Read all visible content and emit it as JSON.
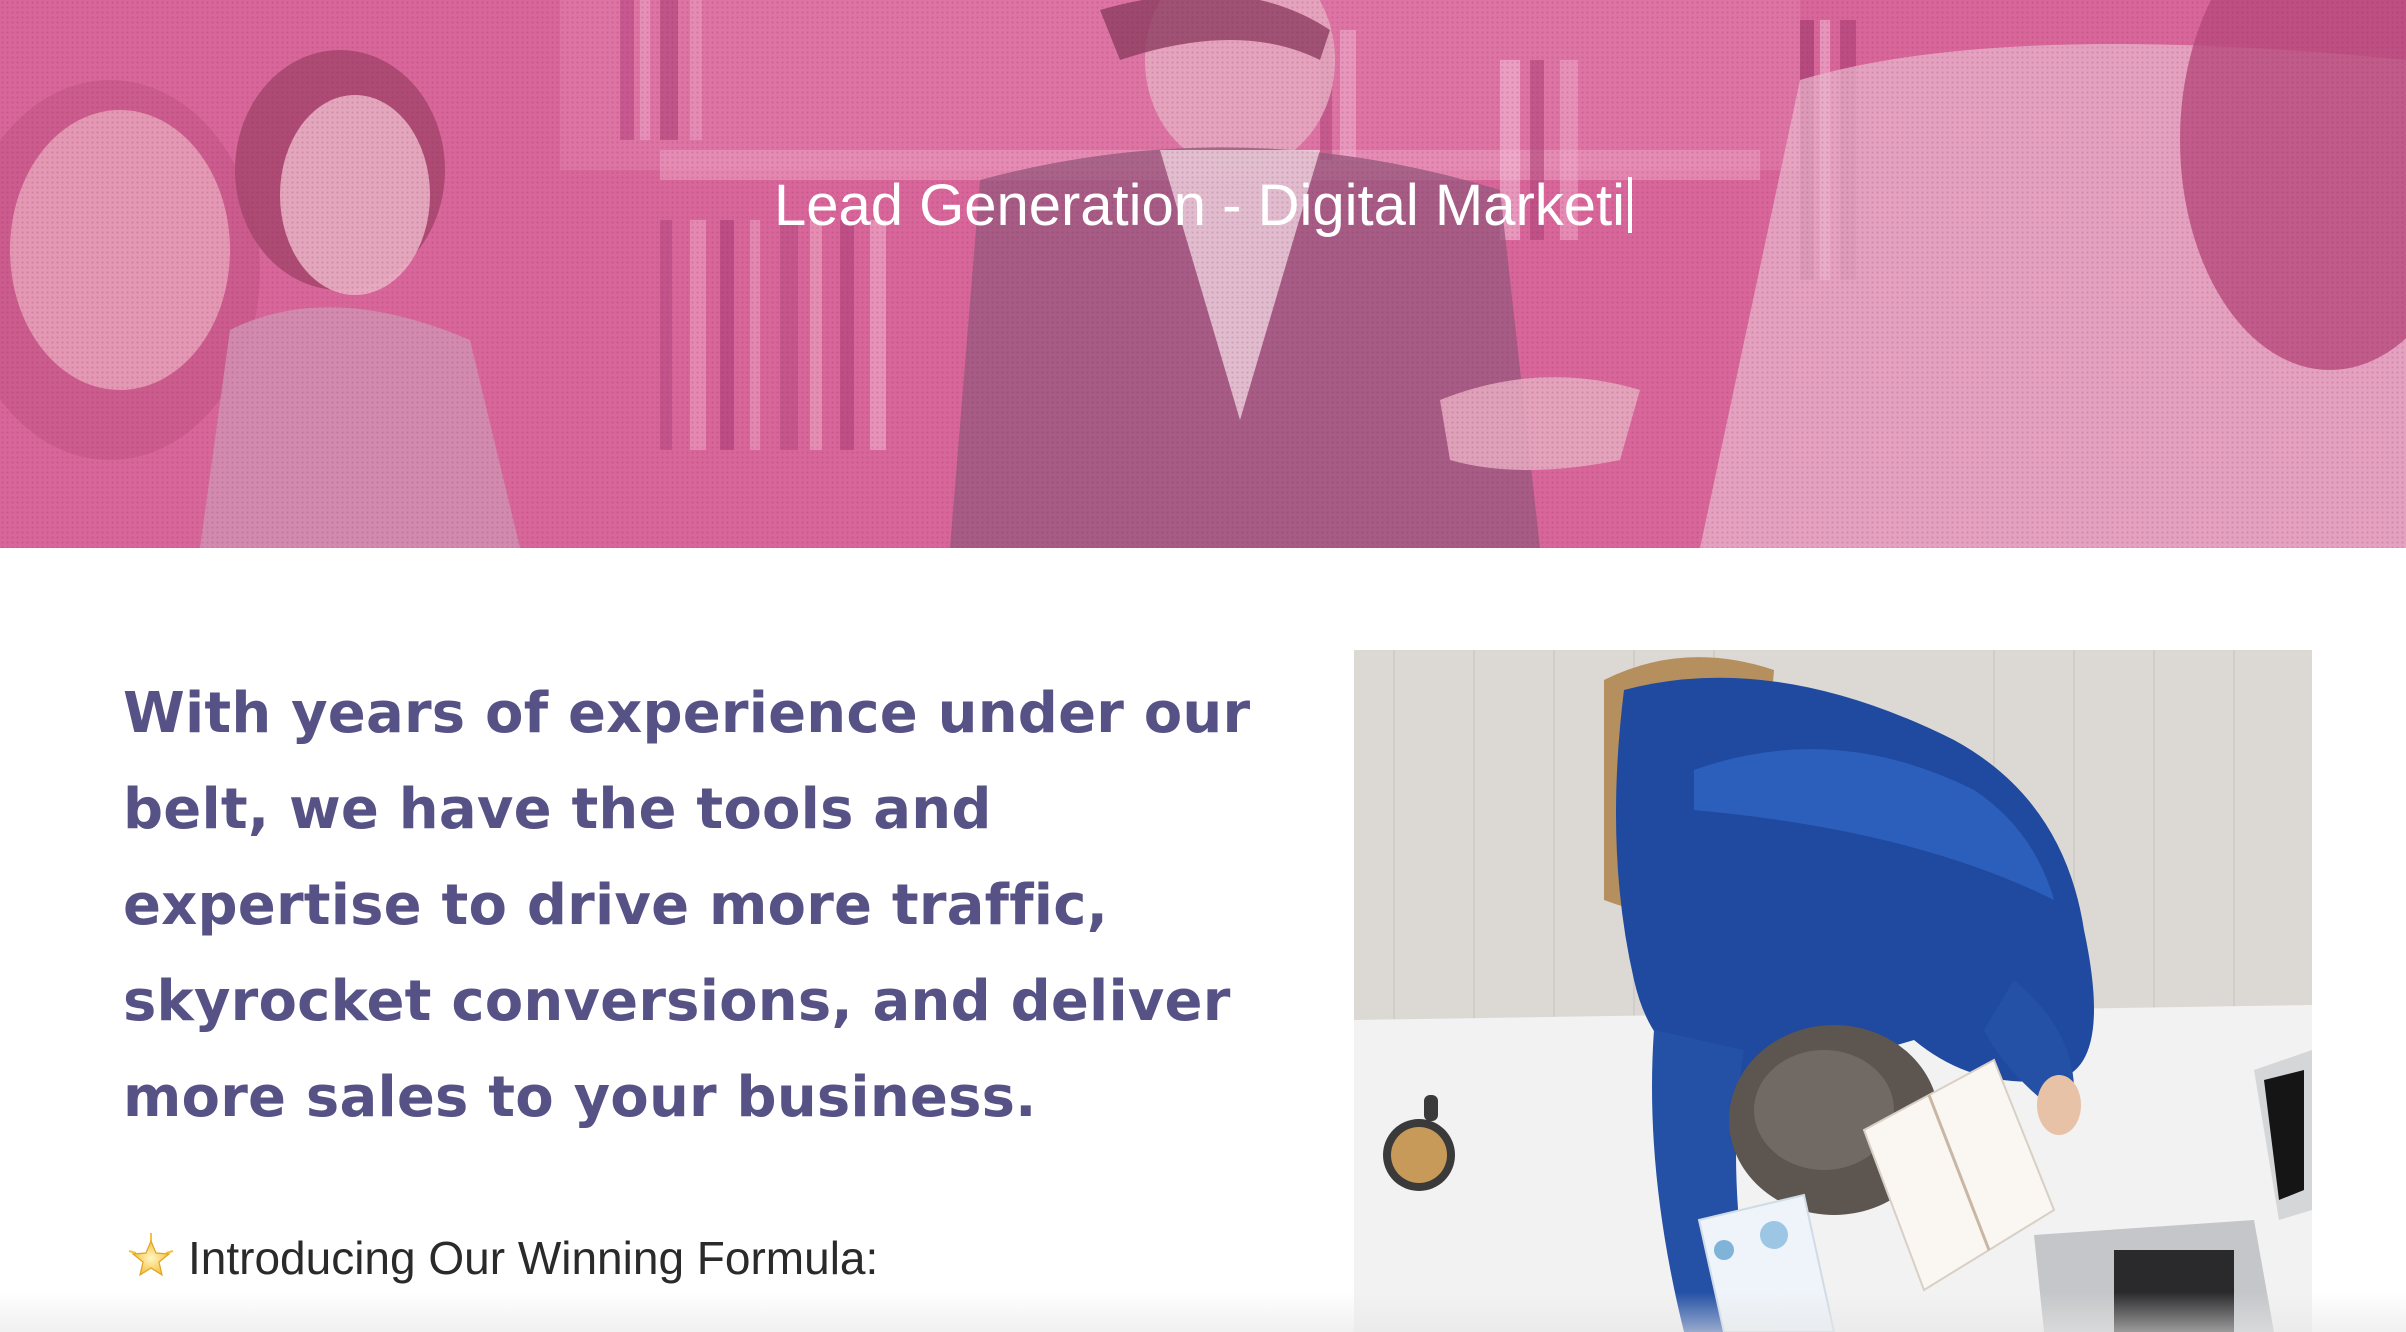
{
  "hero": {
    "title": "Lead Generation - Digital Marketi",
    "overlay_color": "#d9669a"
  },
  "main": {
    "lead_text": "With years of experience under our belt, we have the tools and expertise to drive more traffic, skyrocket conversions, and deliver more sales to your business.",
    "intro": {
      "icon": "star-icon",
      "text": "Introducing Our Winning Formula:"
    }
  },
  "colors": {
    "lead_text": "#575286",
    "hero_overlay": "#d9669a"
  }
}
